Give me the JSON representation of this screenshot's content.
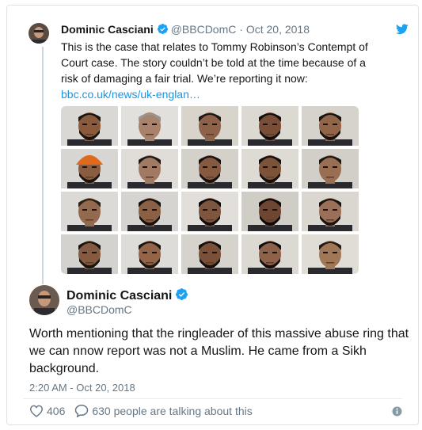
{
  "quoted": {
    "name": "Dominic Casciani",
    "handle": "@BBCDomC",
    "separator": " · ",
    "date": "Oct 20, 2018",
    "text": "This is the case that relates to Tommy Robinson’s Contempt of Court case. The story couldn’t be told at the time because of a risk of damaging a fair trial. We’re reporting it now: ",
    "link": "bbc.co.uk/news/uk-englan…"
  },
  "mugshots": [
    {
      "skin": "#8a5a3c",
      "bg": "#dad8d4",
      "hair": "#1c1410",
      "beard": true,
      "hat": false
    },
    {
      "skin": "#a8826a",
      "bg": "#e2e0dc",
      "hair": "#9a948c",
      "beard": false,
      "hat": false
    },
    {
      "skin": "#8e6248",
      "bg": "#d8d4cc",
      "hair": "#201814",
      "beard": false,
      "hat": false
    },
    {
      "skin": "#7a4e36",
      "bg": "#dcd8d2",
      "hair": "#141010",
      "beard": true,
      "hat": false
    },
    {
      "skin": "#926448",
      "bg": "#d6d2cc",
      "hair": "#181210",
      "beard": true,
      "hat": false
    },
    {
      "skin": "#8a5c40",
      "bg": "#d8d6d2",
      "hair": "#1a1410",
      "beard": true,
      "hat": true
    },
    {
      "skin": "#a07a62",
      "bg": "#e0ddd8",
      "hair": "#1e1814",
      "beard": false,
      "hat": false
    },
    {
      "skin": "#855a40",
      "bg": "#d4d0ca",
      "hair": "#161210",
      "beard": true,
      "hat": false
    },
    {
      "skin": "#7c5238",
      "bg": "#dedad4",
      "hair": "#120e0c",
      "beard": true,
      "hat": false
    },
    {
      "skin": "#9a6e52",
      "bg": "#d2cec8",
      "hair": "#1c1612",
      "beard": false,
      "hat": false
    },
    {
      "skin": "#946a4e",
      "bg": "#dcdad6",
      "hair": "#2a2018",
      "beard": false,
      "hat": false
    },
    {
      "skin": "#8c6044",
      "bg": "#d6d4d0",
      "hair": "#161210",
      "beard": true,
      "hat": false
    },
    {
      "skin": "#7e5640",
      "bg": "#e2dfda",
      "hair": "#100c0a",
      "beard": true,
      "hat": false
    },
    {
      "skin": "#6e4632",
      "bg": "#d0ccc6",
      "hair": "#0e0a08",
      "beard": true,
      "hat": false
    },
    {
      "skin": "#9c7058",
      "bg": "#dad6d0",
      "hair": "#1a1410",
      "beard": true,
      "hat": false
    },
    {
      "skin": "#845a40",
      "bg": "#d4d2ce",
      "hair": "#181410",
      "beard": true,
      "hat": false
    },
    {
      "skin": "#946448",
      "bg": "#dedcd8",
      "hair": "#1c1612",
      "beard": true,
      "hat": false
    },
    {
      "skin": "#7a5038",
      "bg": "#d6d2cc",
      "hair": "#141010",
      "beard": true,
      "hat": false
    },
    {
      "skin": "#8e624a",
      "bg": "#dcd8d2",
      "hair": "#120e0c",
      "beard": true,
      "hat": false
    },
    {
      "skin": "#a07858",
      "bg": "#e0dcd6",
      "hair": "#241c16",
      "beard": false,
      "hat": false
    }
  ],
  "tweet": {
    "name": "Dominic Casciani",
    "handle": "@BBCDomC",
    "text": "Worth mentioning that the ringleader of this massive abuse ring that we can nnow report was not a Muslim. He came from a Sikh background.",
    "timestamp": "2:20 AM - Oct 20, 2018",
    "likes": "406",
    "replies": "630 people are talking about this"
  },
  "icons": [
    "verified-badge-icon",
    "twitter-bird-icon",
    "heart-icon",
    "reply-bubble-icon",
    "info-icon"
  ],
  "colors": {
    "accent": "#1da1f2",
    "link": "#1b95e0",
    "muted": "#657786",
    "thread": "#ccd6dd"
  }
}
